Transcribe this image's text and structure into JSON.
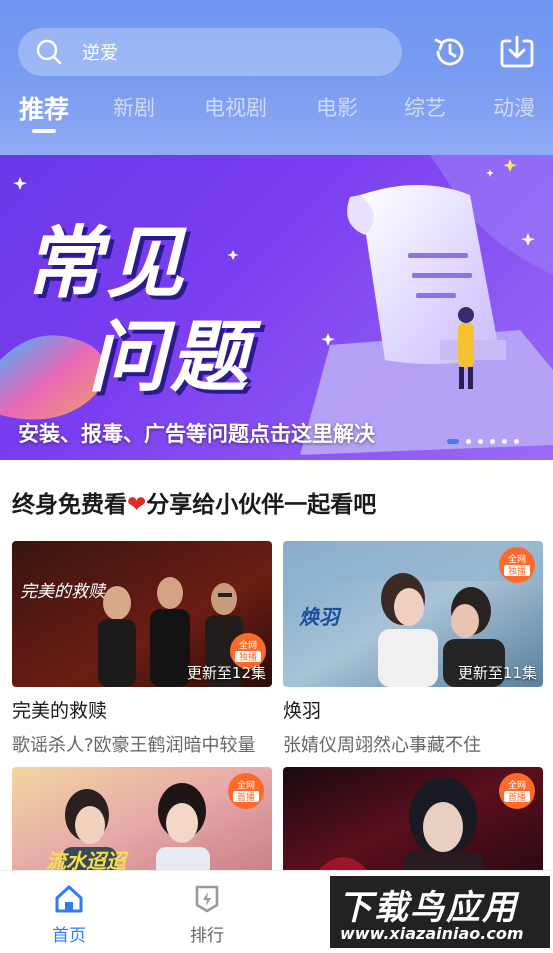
{
  "search": {
    "placeholder_text": "逆爱"
  },
  "header_icons": {
    "history": "history-clock-icon",
    "download": "download-icon"
  },
  "tabs": [
    {
      "label": "推荐",
      "active": true
    },
    {
      "label": "新剧",
      "active": false
    },
    {
      "label": "电视剧",
      "active": false
    },
    {
      "label": "电影",
      "active": false
    },
    {
      "label": "综艺",
      "active": false
    },
    {
      "label": "动漫",
      "active": false
    }
  ],
  "banner": {
    "title_line1": "常见",
    "title_line2": "问题",
    "caption": "安装、报毒、广告等问题点击这里解决",
    "dot_count": 6,
    "active_dot": 0
  },
  "section": {
    "title_before": "终身免费看",
    "heart": "❤",
    "title_after": "分享给小伙伴一起看吧"
  },
  "cards": [
    {
      "title": "完美的救赎",
      "desc": "歌谣杀人?欧豪王鹤润暗中较量",
      "update": "更新至12集",
      "badge": "全网独播",
      "poster_text": "完美的救赎"
    },
    {
      "title": "焕羽",
      "desc": "张婧仪周翊然心事藏不住",
      "update": "更新至11集",
      "badge": "全网独播",
      "poster_text": "焕羽"
    },
    {
      "title": "",
      "desc": "",
      "update": "",
      "badge": "全网首播",
      "poster_text": "流水迢迢"
    },
    {
      "title": "",
      "desc": "",
      "update": "",
      "badge": "全网首播",
      "poster_text": ""
    }
  ],
  "bottom_nav": [
    {
      "label": "首页",
      "icon": "home-icon",
      "active": true
    },
    {
      "label": "排行",
      "icon": "ranking-icon",
      "active": false
    }
  ],
  "watermark": {
    "main": "下载鸟应用",
    "url": "www.xiazainiao.com"
  },
  "colors": {
    "header_top": "#6f96ef",
    "accent": "#2f7cf6",
    "banner_purple": "#6a38e8"
  }
}
